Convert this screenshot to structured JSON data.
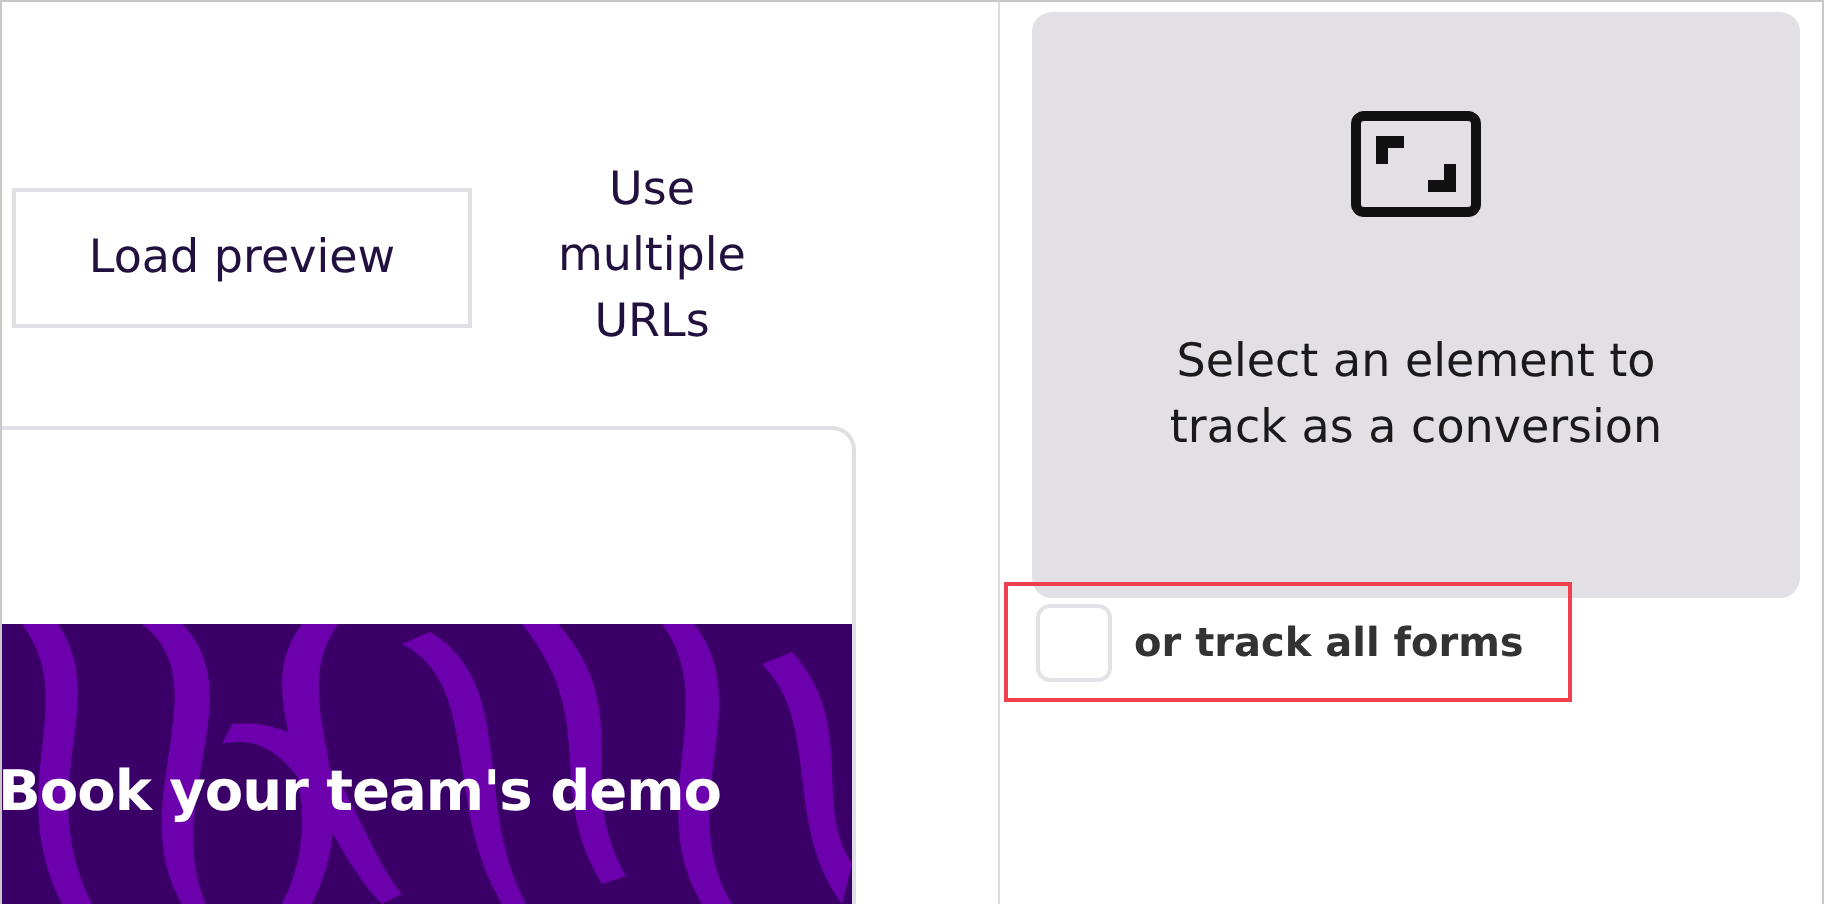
{
  "toolbar": {
    "preview_button": "Load preview",
    "multiple_urls_link": "Use multiple URLs"
  },
  "preview": {
    "banner": {
      "kind": "picture",
      "heading": "Book your team's demo"
    }
  },
  "element_picker": {
    "prompt": "Select an element to track as a conversion"
  },
  "track_all_forms": {
    "label": "or track all forms",
    "checked": false,
    "highlighted": true
  }
}
